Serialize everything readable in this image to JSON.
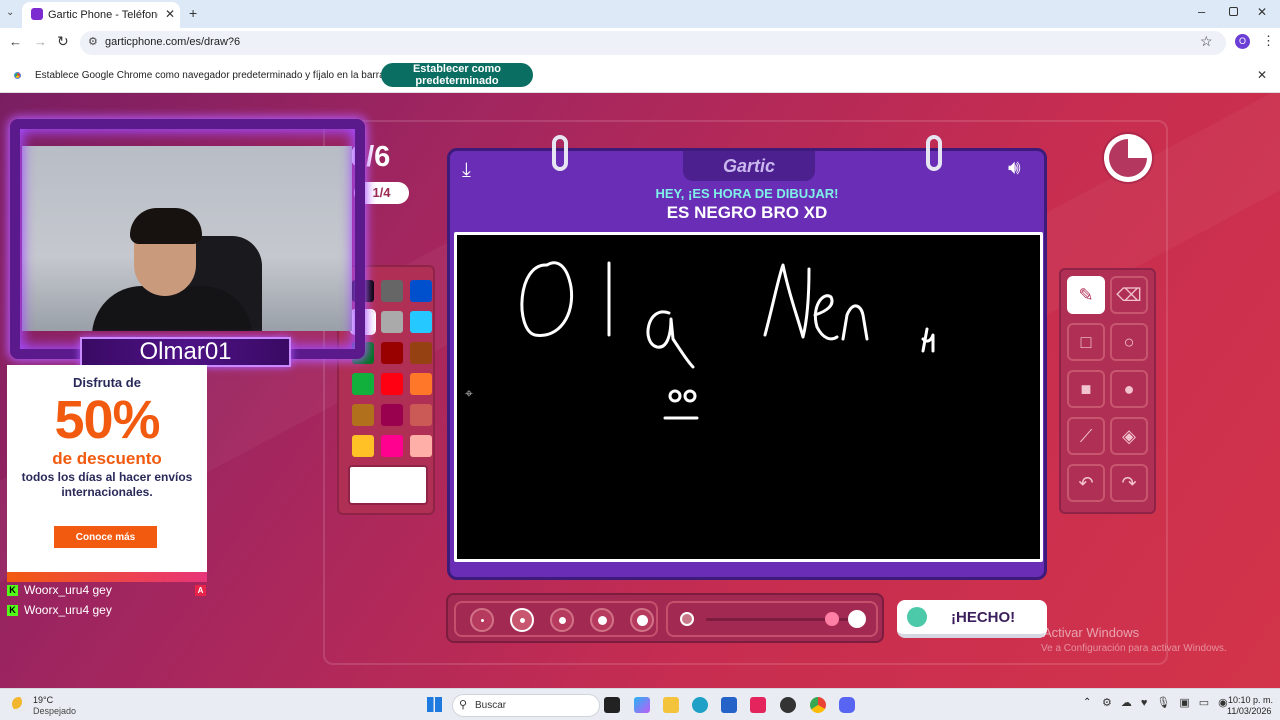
{
  "browser": {
    "tab_title": "Gartic Phone - Teléfono Descon",
    "url": "garticphone.com/es/draw?6",
    "profile_initial": "O",
    "infobar_text": "Establece Google Chrome como navegador predeterminado y fíjalo en la barra de tareas",
    "infobar_button": "Establecer como predeterminado"
  },
  "game": {
    "logo": "Gartic",
    "round_counter": "6/6",
    "round_pill": "1/4",
    "prompt_header": "HEY, ¡ES HORA DE DIBUJAR!",
    "prompt_word": "ES NEGRO BRO XD",
    "done_button": "¡HECHO!",
    "timer_remaining_fraction": 0.75,
    "palette_colors": [
      "#000000",
      "#666666",
      "#0050cd",
      "#ffffff",
      "#aaaaaa",
      "#26c9ff",
      "#017420",
      "#990000",
      "#964112",
      "#11b03c",
      "#ff0013",
      "#ff7829",
      "#b0701c",
      "#99004e",
      "#cb5a57",
      "#ffc126",
      "#ff008f",
      "#feafa8"
    ],
    "palette_custom_color": "#ffffff",
    "tools": [
      "pencil-tool",
      "eraser-tool",
      "rect-outline-tool",
      "ellipse-outline-tool",
      "rect-fill-tool",
      "ellipse-fill-tool",
      "line-tool",
      "fill-bucket-tool",
      "undo-tool",
      "redo-tool"
    ],
    "selected_tool": "pencil-tool",
    "brush_sizes": 5,
    "selected_brush_size": 2,
    "opacity_fraction": 0.85
  },
  "overlay": {
    "streamer_name": "Olmar01",
    "chat": [
      {
        "badge": "K",
        "user": "Woorx_uru4",
        "message": "gey"
      },
      {
        "badge": "K",
        "user": "Woorx_uru4",
        "message": "gey"
      }
    ],
    "chat_side_badge": "A"
  },
  "ad": {
    "line1": "Disfruta de",
    "big": "50%",
    "line2": "de descuento",
    "line3": "todos los días al hacer envíos internacionales.",
    "button": "Conoce más"
  },
  "windows": {
    "activate_title": "Activar Windows",
    "activate_sub": "Ve a Configuración para activar Windows.",
    "weather_temp": "19°C",
    "weather_desc": "Despejado",
    "search_placeholder": "Buscar",
    "time": "10:10 p. m.",
    "date": "11/03/2026"
  }
}
